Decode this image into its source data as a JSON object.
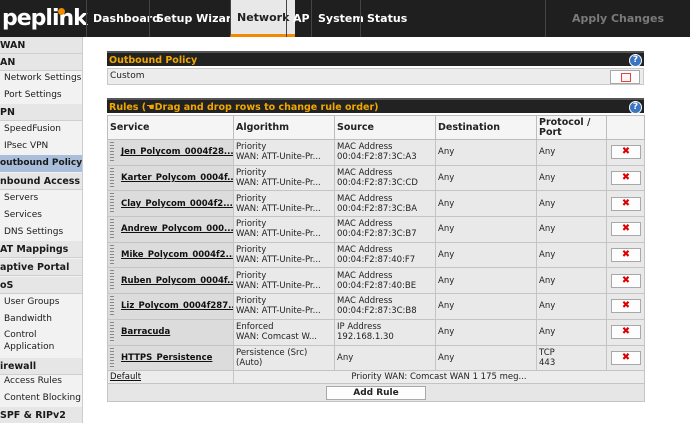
{
  "brand": {
    "name": "peplink"
  },
  "nav": {
    "items": [
      "Dashboard",
      "Setup Wizard",
      "Network",
      "AP",
      "System",
      "Status"
    ],
    "active": "Network",
    "apply_label": "Apply Changes"
  },
  "sidebar": {
    "items": [
      {
        "label": "WAN",
        "type": "head"
      },
      {
        "label": "AN",
        "type": "head"
      },
      {
        "label": "Network Settings",
        "type": "item"
      },
      {
        "label": "Port Settings",
        "type": "item"
      },
      {
        "label": "PN",
        "type": "head"
      },
      {
        "label": "SpeedFusion",
        "type": "item"
      },
      {
        "label": "IPsec VPN",
        "type": "item"
      },
      {
        "label": "outbound Policy",
        "type": "active"
      },
      {
        "label": "nbound Access",
        "type": "head"
      },
      {
        "label": "Servers",
        "type": "item"
      },
      {
        "label": "Services",
        "type": "item"
      },
      {
        "label": "DNS Settings",
        "type": "item"
      },
      {
        "label": "AT Mappings",
        "type": "head"
      },
      {
        "label": "aptive Portal",
        "type": "head"
      },
      {
        "label": "oS",
        "type": "head"
      },
      {
        "label": "User Groups",
        "type": "item"
      },
      {
        "label": "Bandwidth",
        "type": "item"
      },
      {
        "label": "Control",
        "type": "item"
      },
      {
        "label": "Application",
        "type": "item"
      },
      {
        "label": "irewall",
        "type": "head"
      },
      {
        "label": "Access Rules",
        "type": "item"
      },
      {
        "label": "Content Blocking",
        "type": "item"
      },
      {
        "label": "SPF & RIPv2",
        "type": "head"
      }
    ]
  },
  "outbound_policy": {
    "title": "Outbound Policy",
    "value": "Custom",
    "help": "?"
  },
  "rules": {
    "title_prefix": "Rules (",
    "title_hint": "Drag and drop rows to change rule order)",
    "help": "?",
    "columns": [
      "Service",
      "Algorithm",
      "Source",
      "Destination",
      "Protocol / Port"
    ],
    "rows": [
      {
        "service": "Jen_Polycom_0004f28...",
        "alg1": "Priority",
        "alg2": "WAN: ATT-Unite-Pr...",
        "src1": "MAC Address",
        "src2": "00:04:F2:87:3C:A3",
        "dest": "Any",
        "proto1": "Any",
        "proto2": ""
      },
      {
        "service": "Karter_Polycom_0004f...",
        "alg1": "Priority",
        "alg2": "WAN: ATT-Unite-Pr...",
        "src1": "MAC Address",
        "src2": "00:04:F2:87:3C:CD",
        "dest": "Any",
        "proto1": "Any",
        "proto2": ""
      },
      {
        "service": "Clay_Polycom_0004f2...",
        "alg1": "Priority",
        "alg2": "WAN: ATT-Unite-Pr...",
        "src1": "MAC Address",
        "src2": "00:04:F2:87:3C:BA",
        "dest": "Any",
        "proto1": "Any",
        "proto2": ""
      },
      {
        "service": "Andrew_Polycom_000...",
        "alg1": "Priority",
        "alg2": "WAN: ATT-Unite-Pr...",
        "src1": "MAC Address",
        "src2": "00:04:F2:87:3C:B7",
        "dest": "Any",
        "proto1": "Any",
        "proto2": ""
      },
      {
        "service": "Mike_Polycom_0004f2...",
        "alg1": "Priority",
        "alg2": "WAN: ATT-Unite-Pr...",
        "src1": "MAC Address",
        "src2": "00:04:F2:87:40:F7",
        "dest": "Any",
        "proto1": "Any",
        "proto2": ""
      },
      {
        "service": "Ruben_Polycom_0004f...",
        "alg1": "Priority",
        "alg2": "WAN: ATT-Unite-Pr...",
        "src1": "MAC Address",
        "src2": "00:04:F2:87:40:BE",
        "dest": "Any",
        "proto1": "Any",
        "proto2": ""
      },
      {
        "service": "Liz_Polycom_0004f287...",
        "alg1": "Priority",
        "alg2": "WAN: ATT-Unite-Pr...",
        "src1": "MAC Address",
        "src2": "00:04:F2:87:3C:B8",
        "dest": "Any",
        "proto1": "Any",
        "proto2": ""
      },
      {
        "service": "Barracuda",
        "alg1": "Enforced",
        "alg2": "WAN: Comcast W...",
        "src1": "IP Address",
        "src2": "192.168.1.30",
        "dest": "Any",
        "proto1": "Any",
        "proto2": ""
      },
      {
        "service": "HTTPS_Persistence",
        "alg1": "Persistence (Src)",
        "alg2": "(Auto)",
        "src1": "Any",
        "src2": "",
        "dest": "Any",
        "proto1": "TCP",
        "proto2": "443"
      }
    ],
    "default_label": "Default",
    "default_text": "Priority WAN: Comcast WAN 1 175 meg...",
    "delete_glyph": "✖",
    "add_label": "Add Rule"
  },
  "colors": {
    "accent": "#f08a00",
    "header_bg": "#1f1f1f",
    "delete": "#dd0000"
  }
}
